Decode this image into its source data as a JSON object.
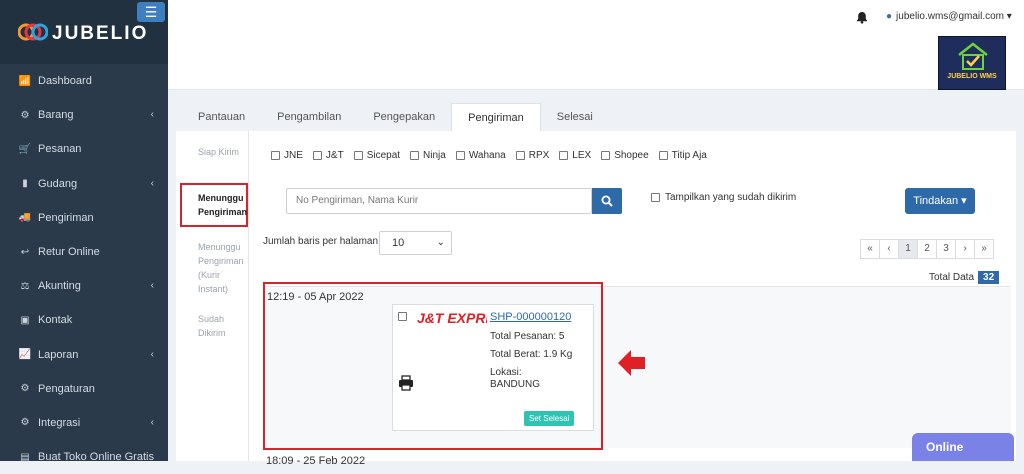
{
  "app": {
    "brand_name": "JUBELIO",
    "menu_toggle": "☰"
  },
  "sidebar": {
    "items": [
      {
        "label": "Dashboard",
        "icon": "📶",
        "chevron": ""
      },
      {
        "label": "Barang",
        "icon": "⚙",
        "chevron": "‹"
      },
      {
        "label": "Pesanan",
        "icon": "🛒",
        "chevron": ""
      },
      {
        "label": "Gudang",
        "icon": "▮",
        "chevron": "‹"
      },
      {
        "label": "Pengiriman",
        "icon": "🚚",
        "chevron": ""
      },
      {
        "label": "Retur Online",
        "icon": "↩",
        "chevron": ""
      },
      {
        "label": "Akunting",
        "icon": "⚖",
        "chevron": "‹"
      },
      {
        "label": "Kontak",
        "icon": "▣",
        "chevron": ""
      },
      {
        "label": "Laporan",
        "icon": "📈",
        "chevron": "‹"
      },
      {
        "label": "Pengaturan",
        "icon": "⚙",
        "chevron": ""
      },
      {
        "label": "Integrasi",
        "icon": "⚙",
        "chevron": "‹"
      },
      {
        "label": "Buat Toko Online Gratis",
        "icon": "▤",
        "chevron": ""
      }
    ]
  },
  "header": {
    "user_email": "jubelio.wms@gmail.com",
    "caret": "▾",
    "wms_logo_text": "JUBELIO WMS"
  },
  "tabs": [
    {
      "label": "Pantauan",
      "active": false
    },
    {
      "label": "Pengambilan",
      "active": false
    },
    {
      "label": "Pengepakan",
      "active": false
    },
    {
      "label": "Pengiriman",
      "active": true
    },
    {
      "label": "Selesai",
      "active": false
    }
  ],
  "subnav": [
    {
      "label": "Siap Kirim"
    },
    {
      "label": "Menunggu Pengiriman"
    },
    {
      "label": "Menunggu Pengiriman (Kurir Instant)"
    },
    {
      "label": "Sudah Dikirim"
    }
  ],
  "couriers": [
    "JNE",
    "J&T",
    "Sicepat",
    "Ninja",
    "Wahana",
    "RPX",
    "LEX",
    "Shopee",
    "Titip Aja"
  ],
  "search": {
    "placeholder": "No Pengiriman, Nama Kurir"
  },
  "show_sent_label": "Tampilkan yang sudah dikirim",
  "action_button": "Tindakan ▾",
  "rows": {
    "label": "Jumlah baris per halaman",
    "value": "10",
    "caret": "⌄"
  },
  "pagination": [
    "«",
    "‹",
    "1",
    "2",
    "3",
    "›",
    "»"
  ],
  "total": {
    "label": "Total Data",
    "value": "32"
  },
  "groups": [
    {
      "date": "12:19 - 05 Apr 2022",
      "card": {
        "courier_logo": "J&T EXPRESS",
        "shipment_no": "SHP-000000120",
        "total_orders": "Total Pesanan: 5",
        "total_weight": "Total Berat: 1.9 Kg",
        "location_label": "Lokasi:",
        "location_value": "BANDUNG",
        "action": "Set Selesai"
      }
    },
    {
      "date": "18:09 - 25 Feb 2022"
    }
  ],
  "chat": {
    "label": "Online"
  },
  "colors": {
    "sidebar": "#2b3a4a",
    "primary": "#2f6aa8",
    "highlight": "#d6252a",
    "success": "#2ec3b3",
    "chat": "#7a82e8"
  }
}
